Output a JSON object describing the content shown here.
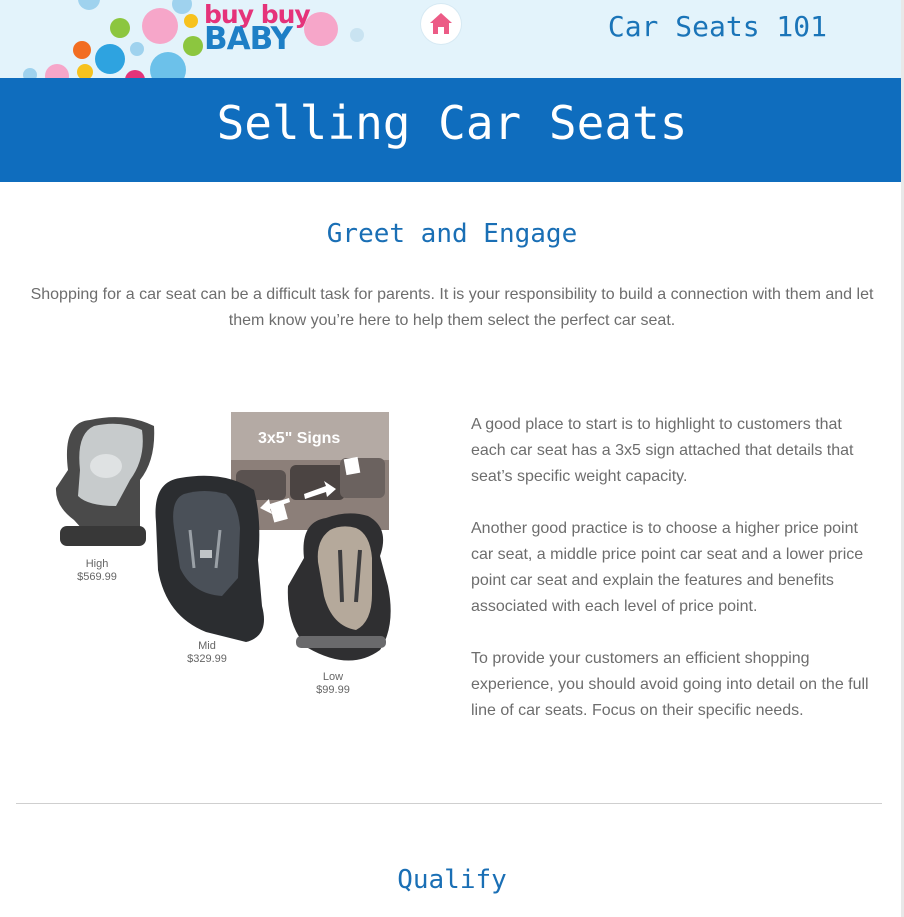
{
  "header": {
    "logo_line1": "buy buy",
    "logo_line2": "BABY",
    "course_title": "Car Seats 101",
    "home_icon": "home-icon"
  },
  "banner": {
    "title": "Selling Car Seats"
  },
  "section1": {
    "heading": "Greet and Engage",
    "intro": "Shopping for a car seat can be a difficult task for parents. It is your responsibility to build a connection with them and let them know you’re here to help them select the perfect car seat.",
    "figure": {
      "signs_label": "3x5\" Signs",
      "seats": [
        {
          "level": "High",
          "price": "$569.99"
        },
        {
          "level": "Mid",
          "price": "$329.99"
        },
        {
          "level": "Low",
          "price": "$99.99"
        }
      ]
    },
    "paragraphs": [
      "A good place to start is to highlight to customers that each car seat has a 3x5 sign attached that details that seat’s specific weight capacity.",
      "Another good practice is to choose a higher price point car seat, a middle price point car seat and a lower price point car seat and explain the features and benefits associated with each level of price point.",
      "To provide your customers an efficient shopping experience, you should avoid going into detail on the full line of car seats. Focus on their specific needs."
    ]
  },
  "section2": {
    "heading": "Qualify"
  },
  "colors": {
    "brand_blue": "#0f6dbe",
    "brand_pink": "#e5337a",
    "heading_blue": "#1a6fb5",
    "topbar_bg": "#e3f3fb"
  }
}
